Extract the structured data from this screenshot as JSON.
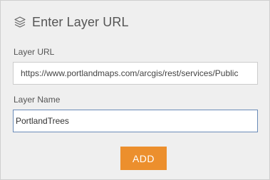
{
  "header": {
    "title": "Enter Layer URL",
    "icon": "layers-icon"
  },
  "form": {
    "url_label": "Layer URL",
    "url_value": "https://www.portlandmaps.com/arcgis/rest/services/Public",
    "name_label": "Layer Name",
    "name_value": "PortlandTrees",
    "add_label": "ADD"
  },
  "colors": {
    "panel_background": "#efefef",
    "add_button": "#ec8f2d",
    "focused_input_border": "#6a8bb8"
  }
}
